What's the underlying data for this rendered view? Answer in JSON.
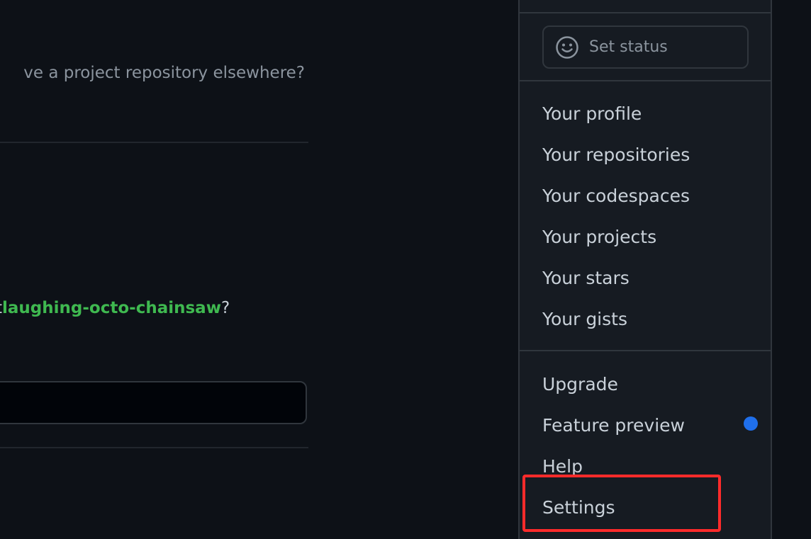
{
  "background": {
    "import_hint": "ve a project repository elsewhere?",
    "confirm_prefix": "t ",
    "repo_name": "laughing-octo-chainsaw",
    "confirm_suffix": "?",
    "confirm_input_value": ""
  },
  "dropdown": {
    "set_status_label": "Set status",
    "items_group1": [
      {
        "label": "Your profile"
      },
      {
        "label": "Your repositories"
      },
      {
        "label": "Your codespaces"
      },
      {
        "label": "Your projects"
      },
      {
        "label": "Your stars"
      },
      {
        "label": "Your gists"
      }
    ],
    "items_group2": [
      {
        "label": "Upgrade"
      },
      {
        "label": "Feature preview",
        "has_new_indicator": true
      },
      {
        "label": "Help"
      },
      {
        "label": "Settings",
        "highlighted": true
      }
    ]
  },
  "colors": {
    "page_bg": "#0d1117",
    "menu_bg": "#161b22",
    "border": "#30363d",
    "text": "#c9d1d9",
    "muted_text": "#8b949e",
    "repo_link": "#3fb950",
    "indicator_dot": "#1f6feb",
    "highlight_box": "#ff2b2b"
  },
  "icons": {
    "set_status_icon": "smiley-icon"
  }
}
